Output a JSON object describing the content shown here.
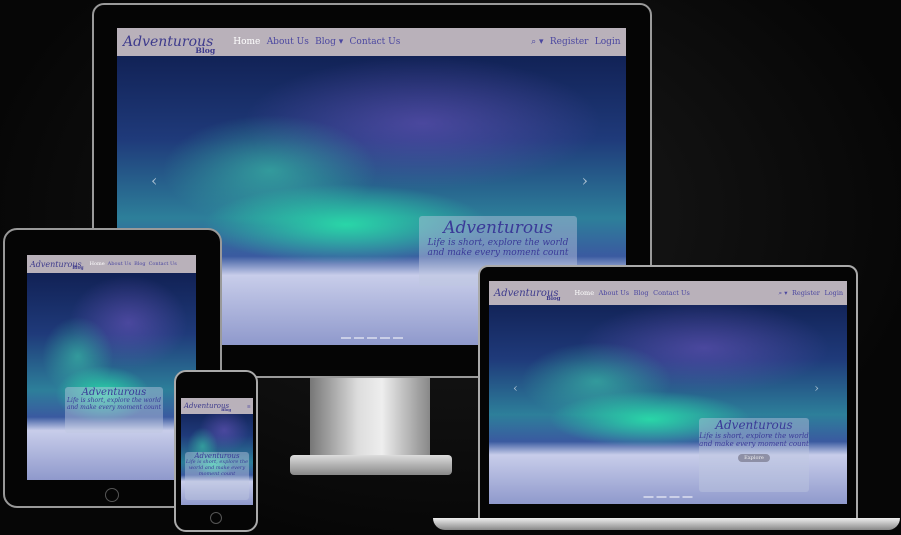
{
  "site": {
    "logo": "Adventurous",
    "logo_sub": "Blog",
    "nav": {
      "home": "Home",
      "about": "About Us",
      "blog": "Blog",
      "contact": "Contact Us",
      "register": "Register",
      "login": "Login",
      "search_icon": "search-icon",
      "caret_icon": "caret-down-icon"
    },
    "hero": {
      "title": "Adventurous",
      "subtitle": "Life is short, explore the world and make every moment count",
      "button": "Explore",
      "prev": "‹",
      "next": "›"
    }
  },
  "colors": {
    "nav_bg": "#c8bec3",
    "nav_text": "#4b47a0",
    "device_frame": "#0a0a0a"
  }
}
